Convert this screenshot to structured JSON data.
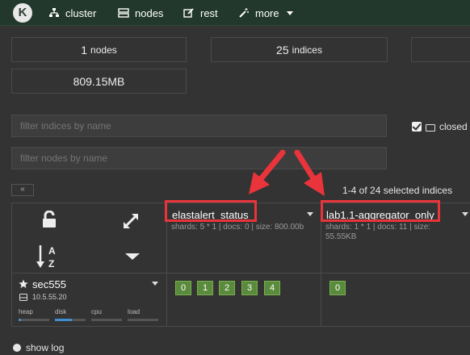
{
  "nav": {
    "logo_letter": "K",
    "items": [
      {
        "label": "cluster",
        "icon": "sitemap-icon"
      },
      {
        "label": "nodes",
        "icon": "server-icon"
      },
      {
        "label": "rest",
        "icon": "edit-icon"
      },
      {
        "label": "more",
        "icon": "magic-wand-icon"
      }
    ]
  },
  "stats": {
    "nodes": {
      "value": "1",
      "label": "nodes"
    },
    "indices": {
      "value": "25",
      "label": "indices"
    },
    "size": "809.15MB"
  },
  "filters": {
    "indices_placeholder": "filter indices by name",
    "nodes_placeholder": "filter nodes by name",
    "closed_label": "closed"
  },
  "pager": {
    "prev_label": "«",
    "count_text": "1-4 of 24 selected indices"
  },
  "indices": [
    {
      "name": "elastalert_status",
      "info": "shards: 5 * 1 | docs: 0 | size: 800.00b",
      "shards": [
        "0",
        "1",
        "2",
        "3",
        "4"
      ]
    },
    {
      "name": "lab1.1-aggregator_only",
      "info": "shards: 1 * 1 | docs: 11 | size: 55.55KB",
      "shards": [
        "0"
      ]
    }
  ],
  "node": {
    "name": "sec555",
    "ip": "10.5.55.20",
    "metrics": [
      {
        "label": "heap",
        "fill": 0.08
      },
      {
        "label": "disk",
        "fill": 0.55
      },
      {
        "label": "cpu",
        "fill": 0.0
      },
      {
        "label": "load",
        "fill": 0.0
      }
    ]
  },
  "footer": {
    "show_log": "show log"
  },
  "colors": {
    "nav_bg": "#22382c",
    "shard_green": "#5a8a3c",
    "highlight_red": "#e8343a",
    "bar_blue": "#3e8ed0"
  }
}
